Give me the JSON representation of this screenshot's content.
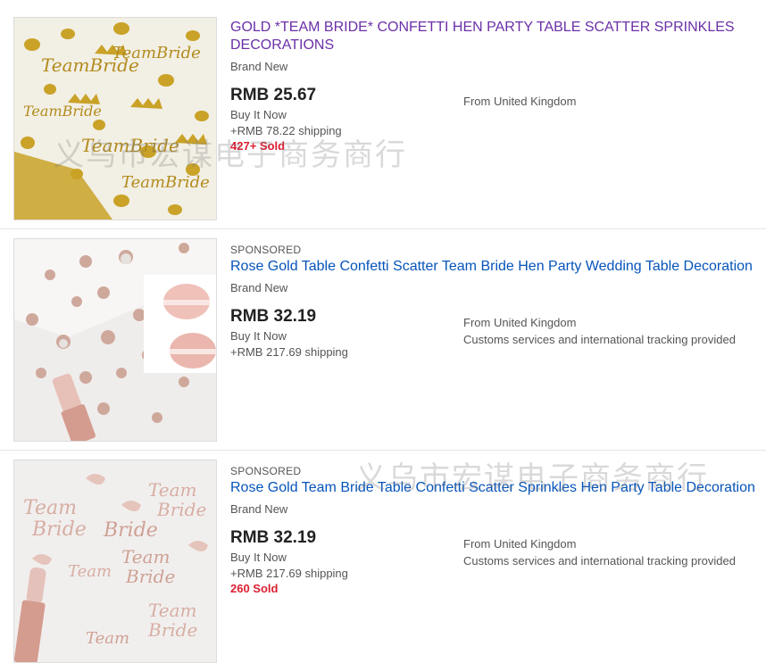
{
  "listings": [
    {
      "sponsored": "",
      "title": "GOLD *TEAM BRIDE* CONFETTI HEN PARTY TABLE SCATTER SPRINKLES DECORATIONS",
      "condition": "Brand New",
      "price": "RMB 25.67",
      "buy_format": "Buy It Now",
      "shipping": "+RMB 78.22 shipping",
      "sold": "427+ Sold",
      "origin": "From United Kingdom",
      "extra": ""
    },
    {
      "sponsored": "SPONSORED",
      "title": "Rose Gold Table Confetti Scatter Team Bride Hen Party Wedding Table Decoration",
      "condition": "Brand New",
      "price": "RMB 32.19",
      "buy_format": "Buy It Now",
      "shipping": "+RMB 217.69 shipping",
      "sold": "",
      "origin": "From United Kingdom",
      "extra": "Customs services and international tracking provided"
    },
    {
      "sponsored": "SPONSORED",
      "title": "Rose Gold Team Bride Table Confetti Scatter Sprinkles Hen Party Table Decoration",
      "condition": "Brand New",
      "price": "RMB 32.19",
      "buy_format": "Buy It Now",
      "shipping": "+RMB 217.69 shipping",
      "sold": "260 Sold",
      "origin": "From United Kingdom",
      "extra": "Customs services and international tracking provided"
    }
  ],
  "watermark": "义乌市宏谋电子商务商行",
  "colors": {
    "link": "#0654ba",
    "visited_link": "#6b2fa8",
    "sold": "#dd1e31",
    "gold": "#c9a227",
    "rose_gold": "#d9a9a0"
  },
  "images": [
    "gold-team-bride-confetti",
    "rose-gold-dot-confetti",
    "rose-gold-team-bride-confetti"
  ]
}
